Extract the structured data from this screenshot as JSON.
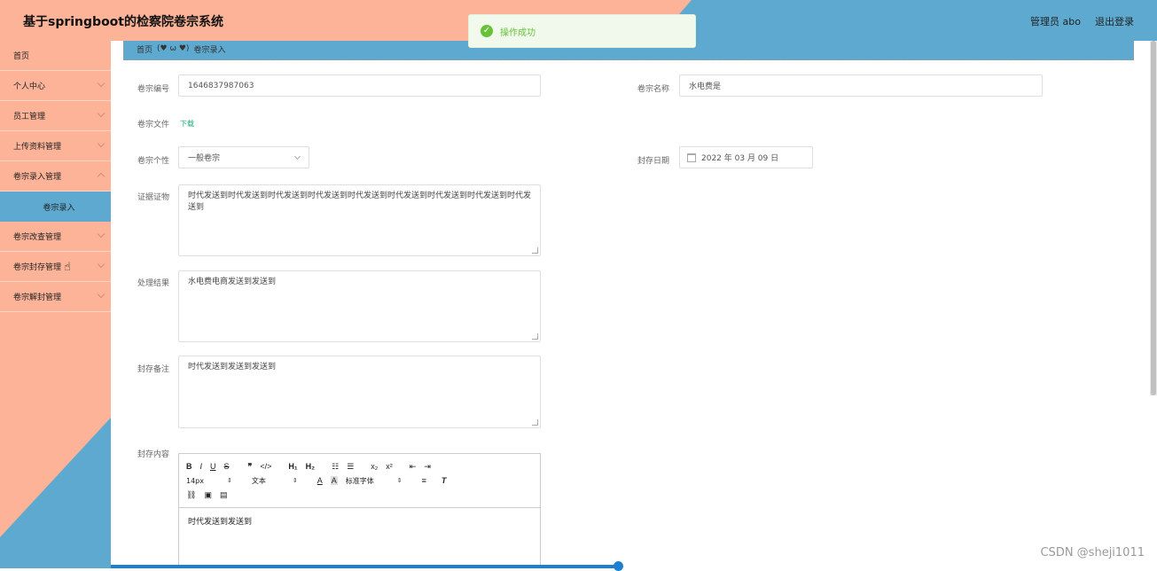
{
  "header": {
    "app_title": "基于springboot的检察院卷宗系统",
    "user_label": "管理员 abo",
    "logout_label": "退出登录"
  },
  "toast": {
    "icon": "check-icon",
    "message": "操作成功"
  },
  "sidebar": {
    "items": [
      {
        "label": "首页"
      },
      {
        "label": "个人中心"
      },
      {
        "label": "员工管理"
      },
      {
        "label": "上传资料管理"
      },
      {
        "label": "卷宗录入管理"
      },
      {
        "label": "卷宗录入"
      },
      {
        "label": "卷宗改查管理"
      },
      {
        "label": "卷宗封存管理"
      },
      {
        "label": "卷宗解封管理"
      }
    ]
  },
  "breadcrumb": {
    "home": "首页",
    "decor": "(♥ ω ♥)",
    "current": "卷宗录入"
  },
  "form": {
    "case_no_label": "卷宗编号",
    "case_no_value": "1646837987063",
    "case_name_label": "卷宗名称",
    "case_name_value": "水电费是",
    "file_label": "卷宗文件",
    "file_link": "下载",
    "type_label": "卷宗个性",
    "type_value": "一般卷宗",
    "date_label": "封存日期",
    "date_value": "2022 年 03 月 09 日",
    "evidence_label": "证据证物",
    "evidence_value": "时代发送到时代发送到时代发送到时代发送到时代发送到时代发送到时代发送到时代发送到时代发送到",
    "result_label": "处理结果",
    "result_value": "水电费电商发送到发送到",
    "note_label": "封存备注",
    "note_value": "时代发送到发送到发送到",
    "content_label": "封存内容",
    "content_value": "时代发送到发送到"
  },
  "editor": {
    "size_value": "14px",
    "para_value": "文本",
    "font_value": "标准字体"
  },
  "watermark": "CSDN @sheji1011",
  "colors": {
    "salmon": "#fcb398",
    "blue": "#5ea9d0",
    "success": "#67c23a"
  }
}
